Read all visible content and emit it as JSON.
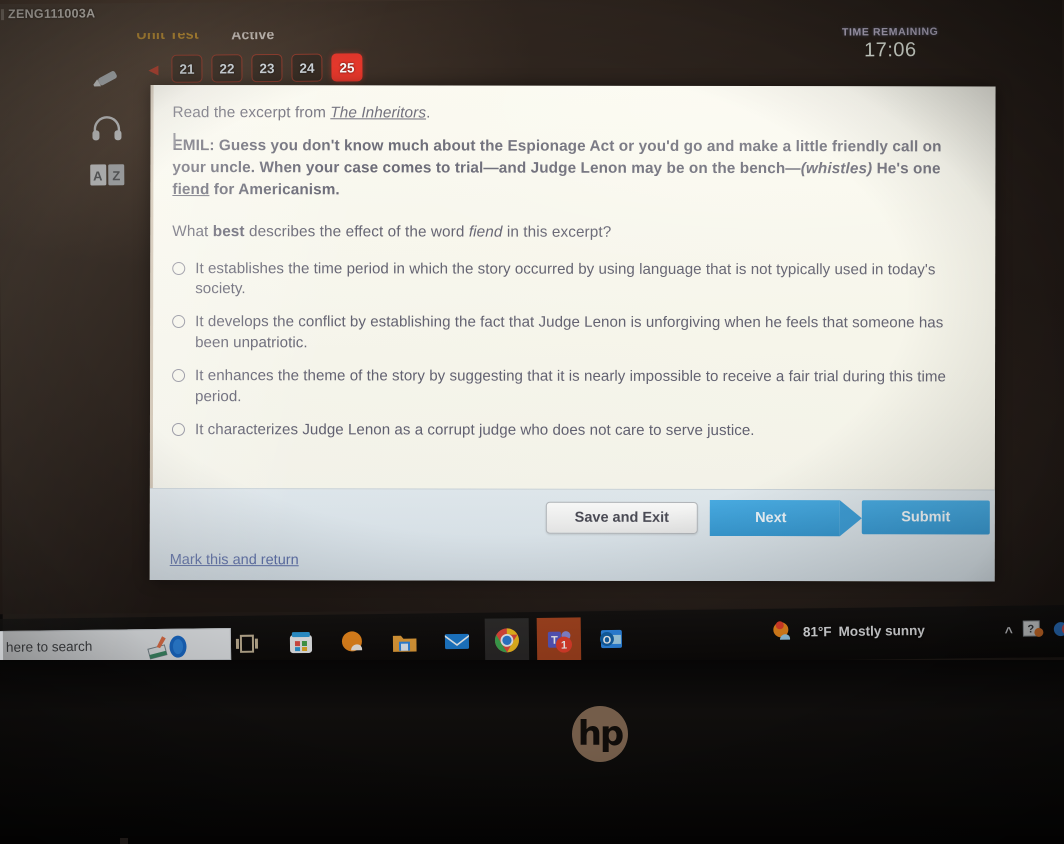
{
  "device": {
    "brand_logo": "hp"
  },
  "app": {
    "student_code": "ZENG111003A",
    "assignment_label": "Unit Test",
    "status_label": "Active",
    "question_tabs": [
      {
        "number": "21",
        "active": false
      },
      {
        "number": "22",
        "active": false
      },
      {
        "number": "23",
        "active": false
      },
      {
        "number": "24",
        "active": false
      },
      {
        "number": "25",
        "active": true
      }
    ],
    "timer": {
      "label": "TIME REMAINING",
      "value": "17:06"
    },
    "tools": [
      {
        "icon": "highlighter-icon",
        "name": "highlighter-tool"
      },
      {
        "icon": "headphones-icon",
        "name": "audio-tool"
      },
      {
        "icon": "dictionary-icon",
        "name": "dictionary-tool"
      }
    ]
  },
  "question": {
    "read_instruction_prefix": "Read the excerpt from ",
    "source_title": "The Inheritors",
    "excerpt": "EMIL: Guess you don't know much about the Espionage Act or you'd go and make a little friendly call on your uncle. When your case comes to trial—and Judge Lenon may be on the bench—(whistles) He's one fiend for Americanism.",
    "excerpt_part1": "EMIL: Guess you don't know much about the Espionage Act or you'd go and make a little friendly call on your uncle. When your case comes to trial—and Judge Lenon may be on the bench—",
    "excerpt_whistles": "(whistles)",
    "excerpt_part2": " He's one ",
    "excerpt_fiend": "fiend",
    "excerpt_part3": " for Americanism.",
    "prompt_pre": "What ",
    "prompt_bold": "best",
    "prompt_mid": " describes the effect of the word ",
    "prompt_italic": "fiend",
    "prompt_post": " in this excerpt?",
    "options": [
      {
        "id": "a",
        "text": "It establishes the time period in which the story occurred by using language that is not typically used in today's society.",
        "selected": false
      },
      {
        "id": "b",
        "text": "It develops the conflict by establishing the fact that Judge Lenon is unforgiving when he feels that someone has been unpatriotic.",
        "selected": false
      },
      {
        "id": "c",
        "text": "It enhances the theme of the story by suggesting that it is nearly impossible to receive a fair trial during this time period.",
        "selected": false
      },
      {
        "id": "d",
        "text": "It characterizes Judge Lenon as a corrupt judge who does not care to serve justice.",
        "selected": false
      }
    ]
  },
  "footer": {
    "save_and_exit_label": "Save and Exit",
    "next_label": "Next",
    "submit_label": "Submit",
    "mark_link_label": "Mark this and return"
  },
  "taskbar": {
    "search_placeholder": "here to search",
    "apps": [
      {
        "name": "task-view-icon"
      },
      {
        "name": "microsoft-store-icon"
      },
      {
        "name": "weather-orb-icon"
      },
      {
        "name": "file-explorer-icon"
      },
      {
        "name": "mail-icon"
      },
      {
        "name": "chrome-icon"
      },
      {
        "name": "teams-icon",
        "badge": "1"
      },
      {
        "name": "outlook-icon"
      }
    ],
    "weather": {
      "temperature": "81°F",
      "condition": "Mostly sunny"
    },
    "tray_chevron": "^"
  },
  "colors": {
    "accent_red": "#e8372b",
    "accent_blue": "#2fa0e0",
    "card_background": "#f7f6ec",
    "text": "#4b4a5e",
    "link": "#4b5f9e"
  }
}
